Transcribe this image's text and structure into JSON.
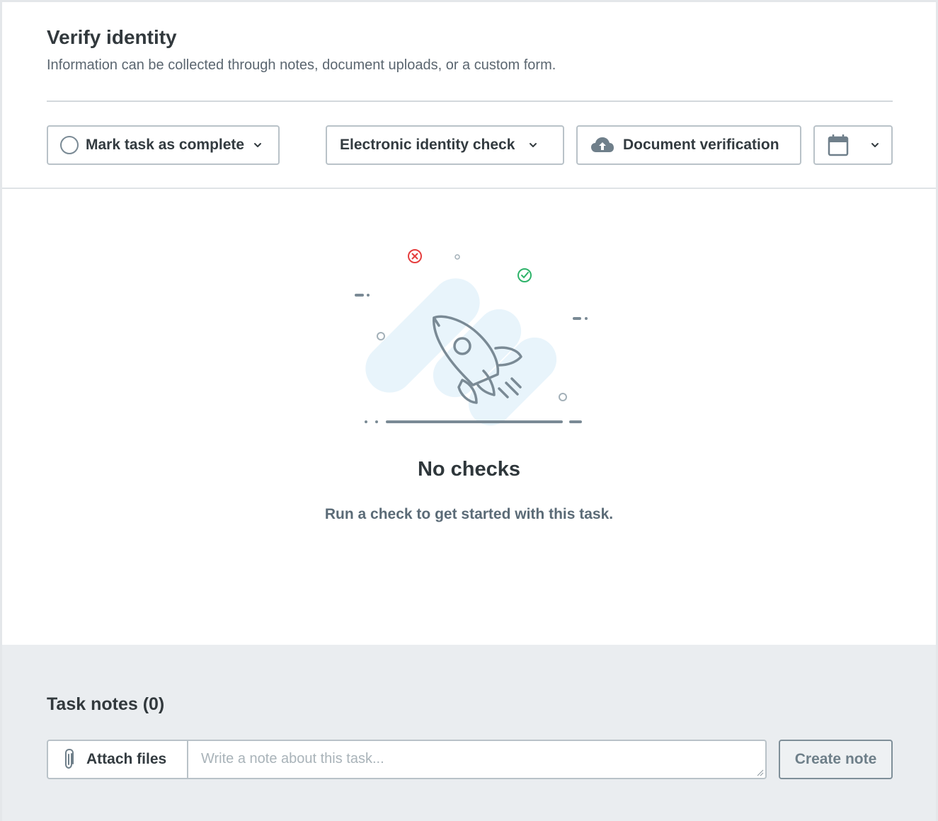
{
  "task": {
    "title": "Verify identity",
    "subtitle": "Information can be collected through notes, document uploads, or a custom form."
  },
  "toolbar": {
    "complete_label": "Mark task as complete",
    "eid_label": "Electronic identity check",
    "doc_label": "Document verification",
    "icons": {
      "complete": "circle-icon",
      "doc": "cloud-upload-icon",
      "calendar": "calendar-icon",
      "dropdown": "chevron-down-icon"
    }
  },
  "empty_state": {
    "title": "No checks",
    "subtitle": "Run a check to get started with this task.",
    "illustration": "rocket-icon"
  },
  "notes": {
    "title": "Task notes (0)",
    "attach_label": "Attach files",
    "placeholder": "Write a note about this task...",
    "value": "",
    "create_label": "Create note"
  },
  "colors": {
    "accent_bg": "#eaedf0",
    "border": "#b9c2c8",
    "illustration_fill": "#e8f4fb",
    "illustration_stroke": "#7a8a95",
    "error": "#e53e3e",
    "success": "#2fb36a"
  }
}
